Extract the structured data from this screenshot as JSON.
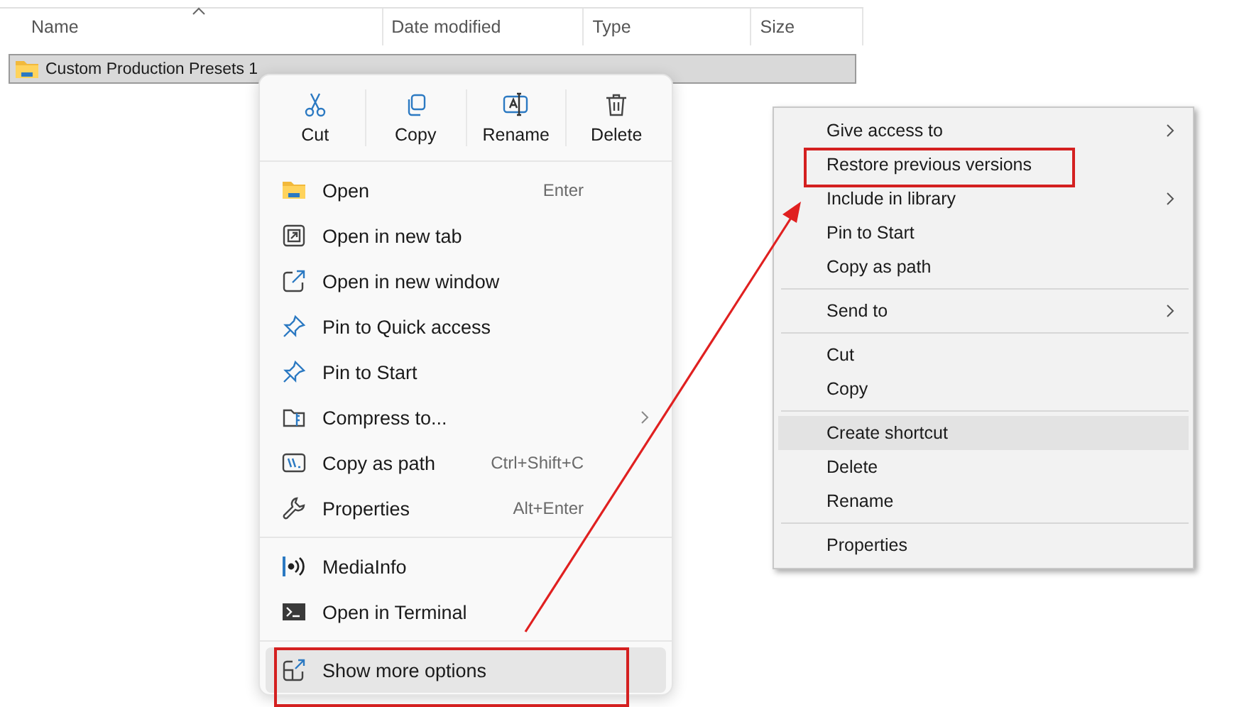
{
  "file_list": {
    "columns": [
      {
        "label": "Name",
        "sorted": true
      },
      {
        "label": "Date modified",
        "sorted": false
      },
      {
        "label": "Type",
        "sorted": false
      },
      {
        "label": "Size",
        "sorted": false
      }
    ],
    "rows": [
      {
        "name": "Custom Production Presets 1",
        "selected": true
      }
    ]
  },
  "context_menu": {
    "actions": [
      {
        "label": "Cut"
      },
      {
        "label": "Copy"
      },
      {
        "label": "Rename"
      },
      {
        "label": "Delete"
      }
    ],
    "items": [
      {
        "kind": "item",
        "label": "Open",
        "shortcut": "Enter",
        "submenu": false,
        "hovered": false,
        "annotated": false
      },
      {
        "kind": "item",
        "label": "Open in new tab",
        "submenu": false,
        "hovered": false,
        "annotated": false
      },
      {
        "kind": "item",
        "label": "Open in new window",
        "submenu": false,
        "hovered": false,
        "annotated": false
      },
      {
        "kind": "item",
        "label": "Pin to Quick access",
        "submenu": false,
        "hovered": false,
        "annotated": false
      },
      {
        "kind": "item",
        "label": "Pin to Start",
        "submenu": false,
        "hovered": false,
        "annotated": false
      },
      {
        "kind": "item",
        "label": "Compress to...",
        "submenu": true,
        "hovered": false,
        "annotated": false
      },
      {
        "kind": "item",
        "label": "Copy as path",
        "shortcut": "Ctrl+Shift+C",
        "submenu": false,
        "hovered": false,
        "annotated": false
      },
      {
        "kind": "item",
        "label": "Properties",
        "shortcut": "Alt+Enter",
        "submenu": false,
        "hovered": false,
        "annotated": false
      },
      {
        "kind": "separator"
      },
      {
        "kind": "item",
        "label": "MediaInfo",
        "submenu": false,
        "hovered": false,
        "annotated": false
      },
      {
        "kind": "item",
        "label": "Open in Terminal",
        "submenu": false,
        "hovered": false,
        "annotated": false
      },
      {
        "kind": "separator"
      },
      {
        "kind": "item",
        "label": "Show more options",
        "submenu": false,
        "hovered": true,
        "annotated": true
      }
    ]
  },
  "classic_menu": {
    "items": [
      {
        "kind": "item",
        "label": "Give access to",
        "submenu": true,
        "hovered": false,
        "annotated": false
      },
      {
        "kind": "item",
        "label": "Restore previous versions",
        "submenu": false,
        "hovered": false,
        "annotated": true
      },
      {
        "kind": "item",
        "label": "Include in library",
        "submenu": true,
        "hovered": false,
        "annotated": false
      },
      {
        "kind": "item",
        "label": "Pin to Start",
        "submenu": false,
        "hovered": false,
        "annotated": false
      },
      {
        "kind": "item",
        "label": "Copy as path",
        "submenu": false,
        "hovered": false,
        "annotated": false
      },
      {
        "kind": "separator"
      },
      {
        "kind": "item",
        "label": "Send to",
        "submenu": true,
        "hovered": false,
        "annotated": false
      },
      {
        "kind": "separator"
      },
      {
        "kind": "item",
        "label": "Cut",
        "submenu": false,
        "hovered": false,
        "annotated": false
      },
      {
        "kind": "item",
        "label": "Copy",
        "submenu": false,
        "hovered": false,
        "annotated": false
      },
      {
        "kind": "separator"
      },
      {
        "kind": "item",
        "label": "Create shortcut",
        "submenu": false,
        "hovered": true,
        "annotated": false
      },
      {
        "kind": "item",
        "label": "Delete",
        "submenu": false,
        "hovered": false,
        "annotated": false
      },
      {
        "kind": "item",
        "label": "Rename",
        "submenu": false,
        "hovered": false,
        "annotated": false
      },
      {
        "kind": "separator"
      },
      {
        "kind": "item",
        "label": "Properties",
        "submenu": false,
        "hovered": false,
        "annotated": false
      }
    ]
  }
}
